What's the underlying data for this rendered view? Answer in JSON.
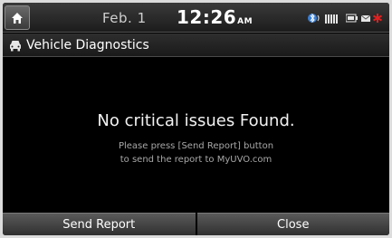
{
  "statusbar": {
    "date": "Feb. 1",
    "time": "12:26",
    "ampm": "AM"
  },
  "titlebar": {
    "title": "Vehicle Diagnostics"
  },
  "content": {
    "headline": "No critical issues Found.",
    "line1": "Please press [Send Report] button",
    "line2": "to send the report to MyUVO.com"
  },
  "buttons": {
    "send_report": "Send Report",
    "close": "Close"
  },
  "colors": {
    "bluetooth": "#3a7fd5",
    "alert": "#e02020"
  }
}
